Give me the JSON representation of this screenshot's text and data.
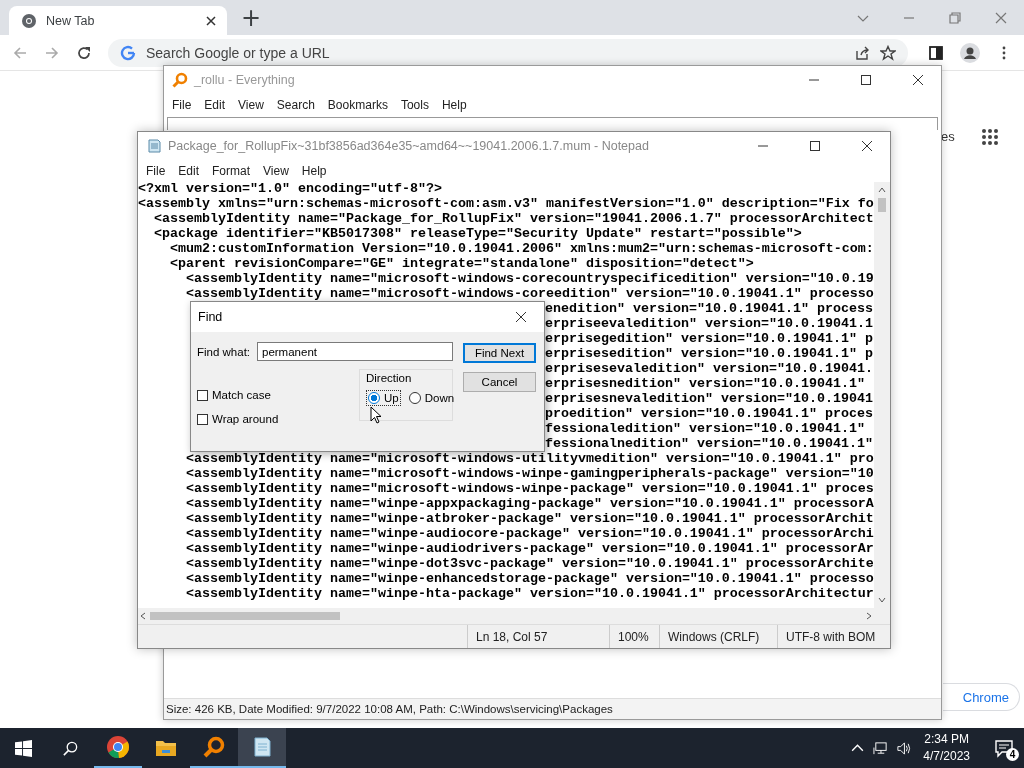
{
  "browser": {
    "tab": {
      "title": "New Tab"
    },
    "new_tab_button": "+",
    "omnibox": {
      "placeholder": "Search Google or type a URL"
    },
    "page": {
      "link_fragment": "es",
      "customize_button": "Chrome"
    }
  },
  "everything": {
    "title": "_rollu - Everything",
    "menu": [
      "File",
      "Edit",
      "View",
      "Search",
      "Bookmarks",
      "Tools",
      "Help"
    ],
    "status_bar": "Size: 426 KB, Date Modified: 9/7/2022 10:08 AM, Path: C:\\Windows\\servicing\\Packages"
  },
  "notepad": {
    "title": "Package_for_RollupFix~31bf3856ad364e35~amd64~~19041.2006.1.7.mum - Notepad",
    "menu": [
      "File",
      "Edit",
      "Format",
      "View",
      "Help"
    ],
    "lines": [
      {
        "kind": "full",
        "text": "<?xml version=\"1.0\" encoding=\"utf-8\"?>"
      },
      {
        "kind": "full",
        "text": "<assembly xmlns=\"urn:schemas-microsoft-com:asm.v3\" manifestVersion=\"1.0\" description=\"Fix fo"
      },
      {
        "kind": "full",
        "text": "  <assemblyIdentity name=\"Package_for_RollupFix\" version=\"19041.2006.1.7\" processorArchitect"
      },
      {
        "kind": "full",
        "text": "  <package identifier=\"KB5017308\" releaseType=\"Security Update\" restart=\"possible\">"
      },
      {
        "kind": "full",
        "text": "    <mum2:customInformation Version=\"10.0.19041.2006\" xmlns:mum2=\"urn:schemas-microsoft-com:"
      },
      {
        "kind": "full",
        "text": "    <parent revisionCompare=\"GE\" integrate=\"standalone\" disposition=\"detect\">"
      },
      {
        "kind": "full",
        "text": "      <assemblyIdentity name=\"microsoft-windows-corecountryspecificedition\" version=\"10.0.19"
      },
      {
        "kind": "full",
        "text": "      <assemblyIdentity name=\"microsoft-windows-coreedition\" version=\"10.0.19041.1\" processo"
      },
      {
        "kind": "partial",
        "text": "enedition\" version=\"10.0.19041.1\" process"
      },
      {
        "kind": "partial",
        "text": "erpriseevaledition\" version=\"10.0.19041.1"
      },
      {
        "kind": "partial",
        "text": "erprisegedition\" version=\"10.0.19041.1\" p"
      },
      {
        "kind": "partial",
        "text": "erprisesedition\" version=\"10.0.19041.1\" p"
      },
      {
        "kind": "partial",
        "text": "erprisesevaledition\" version=\"10.0.19041."
      },
      {
        "kind": "partial",
        "text": "erprisesnedition\" version=\"10.0.19041.1\""
      },
      {
        "kind": "partial",
        "text": "erprisesnevaledition\" version=\"10.0.19041"
      },
      {
        "kind": "partial",
        "text": "proedition\" version=\"10.0.19041.1\" proces"
      },
      {
        "kind": "partial",
        "text": "fessionaledition\" version=\"10.0.19041.1\""
      },
      {
        "kind": "partial",
        "text": "fessionalnedition\" version=\"10.0.19041.1\""
      },
      {
        "kind": "full",
        "text": "      <assemblyIdentity name=\"microsoft-windows-utilityvmedition\" version=\"10.0.19041.1\" pro"
      },
      {
        "kind": "full",
        "text": "      <assemblyIdentity name=\"microsoft-windows-winpe-gamingperipherals-package\" version=\"10"
      },
      {
        "kind": "full",
        "text": "      <assemblyIdentity name=\"microsoft-windows-winpe-package\" version=\"10.0.19041.1\" proces"
      },
      {
        "kind": "full",
        "text": "      <assemblyIdentity name=\"winpe-appxpackaging-package\" version=\"10.0.19041.1\" processorA"
      },
      {
        "kind": "full",
        "text": "      <assemblyIdentity name=\"winpe-atbroker-package\" version=\"10.0.19041.1\" processorArchit"
      },
      {
        "kind": "full",
        "text": "      <assemblyIdentity name=\"winpe-audiocore-package\" version=\"10.0.19041.1\" processorArchi"
      },
      {
        "kind": "full",
        "text": "      <assemblyIdentity name=\"winpe-audiodrivers-package\" version=\"10.0.19041.1\" processorAr"
      },
      {
        "kind": "full",
        "text": "      <assemblyIdentity name=\"winpe-dot3svc-package\" version=\"10.0.19041.1\" processorArchite"
      },
      {
        "kind": "full",
        "text": "      <assemblyIdentity name=\"winpe-enhancedstorage-package\" version=\"10.0.19041.1\" processo"
      },
      {
        "kind": "full",
        "text": "      <assemblyIdentity name=\"winpe-hta-package\" version=\"10.0.19041.1\" processorArchitectur"
      }
    ],
    "status": {
      "position": "Ln 18, Col 57",
      "zoom": "100%",
      "line_endings": "Windows (CRLF)",
      "encoding": "UTF-8 with BOM"
    }
  },
  "find_dialog": {
    "title": "Find",
    "find_what_label": "Find what:",
    "find_what": "permanent",
    "direction_label": "Direction",
    "directions": [
      {
        "label": "Up",
        "selected": true
      },
      {
        "label": "Down",
        "selected": false
      }
    ],
    "options": [
      {
        "label": "Match case",
        "checked": false
      },
      {
        "label": "Wrap around",
        "checked": false
      }
    ],
    "buttons": [
      "Find Next",
      "Cancel"
    ]
  },
  "taskbar": {
    "apps": [
      {
        "kind": "chrome",
        "running": true,
        "active": false
      },
      {
        "kind": "explorer",
        "running": false,
        "active": false
      },
      {
        "kind": "everything",
        "running": true,
        "active": false
      },
      {
        "kind": "notepad",
        "running": true,
        "active": true
      }
    ],
    "time": "2:34 PM",
    "date": "4/7/2023",
    "notifications": "4"
  }
}
